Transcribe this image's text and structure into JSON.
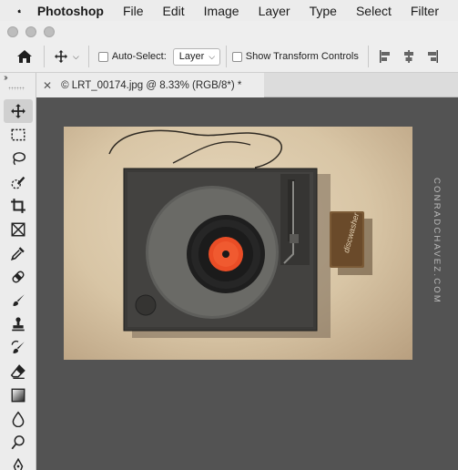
{
  "menubar": {
    "app_name": "Photoshop",
    "items": [
      "File",
      "Edit",
      "Image",
      "Layer",
      "Type",
      "Select",
      "Filter"
    ]
  },
  "options": {
    "auto_select_label": "Auto-Select:",
    "auto_select_target": "Layer",
    "transform_label": "Show Transform Controls"
  },
  "document": {
    "tab_title": "LRT_00174.jpg @ 8.33% (RGB/8*) *"
  },
  "canvas": {
    "watermark": "CONRADCHAVEZ.COM",
    "tag_text": "discwasher"
  },
  "tools": [
    "move-tool",
    "marquee-tool",
    "lasso-tool",
    "quick-selection-tool",
    "crop-tool",
    "frame-tool",
    "eyedropper-tool",
    "healing-brush-tool",
    "brush-tool",
    "clone-stamp-tool",
    "history-brush-tool",
    "eraser-tool",
    "gradient-tool",
    "blur-tool",
    "dodge-tool",
    "pen-tool"
  ]
}
